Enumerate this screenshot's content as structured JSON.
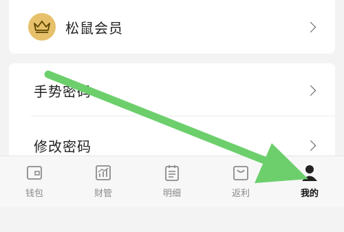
{
  "vip": {
    "label": "松鼠会员",
    "icon": "crown-icon"
  },
  "settings": [
    {
      "label": "手势密码"
    },
    {
      "label": "修改密码"
    }
  ],
  "tabbar": {
    "items": [
      {
        "label": "钱包",
        "icon": "wallet-icon"
      },
      {
        "label": "财管",
        "icon": "bar-chart-icon"
      },
      {
        "label": "明细",
        "icon": "clipboard-list-icon"
      },
      {
        "label": "返利",
        "icon": "shopping-bag-icon"
      },
      {
        "label": "我的",
        "icon": "person-icon"
      }
    ],
    "active_index": 4
  },
  "colors": {
    "accent_gold": "#e6c06a",
    "annotation_arrow": "#6ccf6c",
    "active_tab": "#111111",
    "inactive_tab": "#8a8a8a"
  }
}
